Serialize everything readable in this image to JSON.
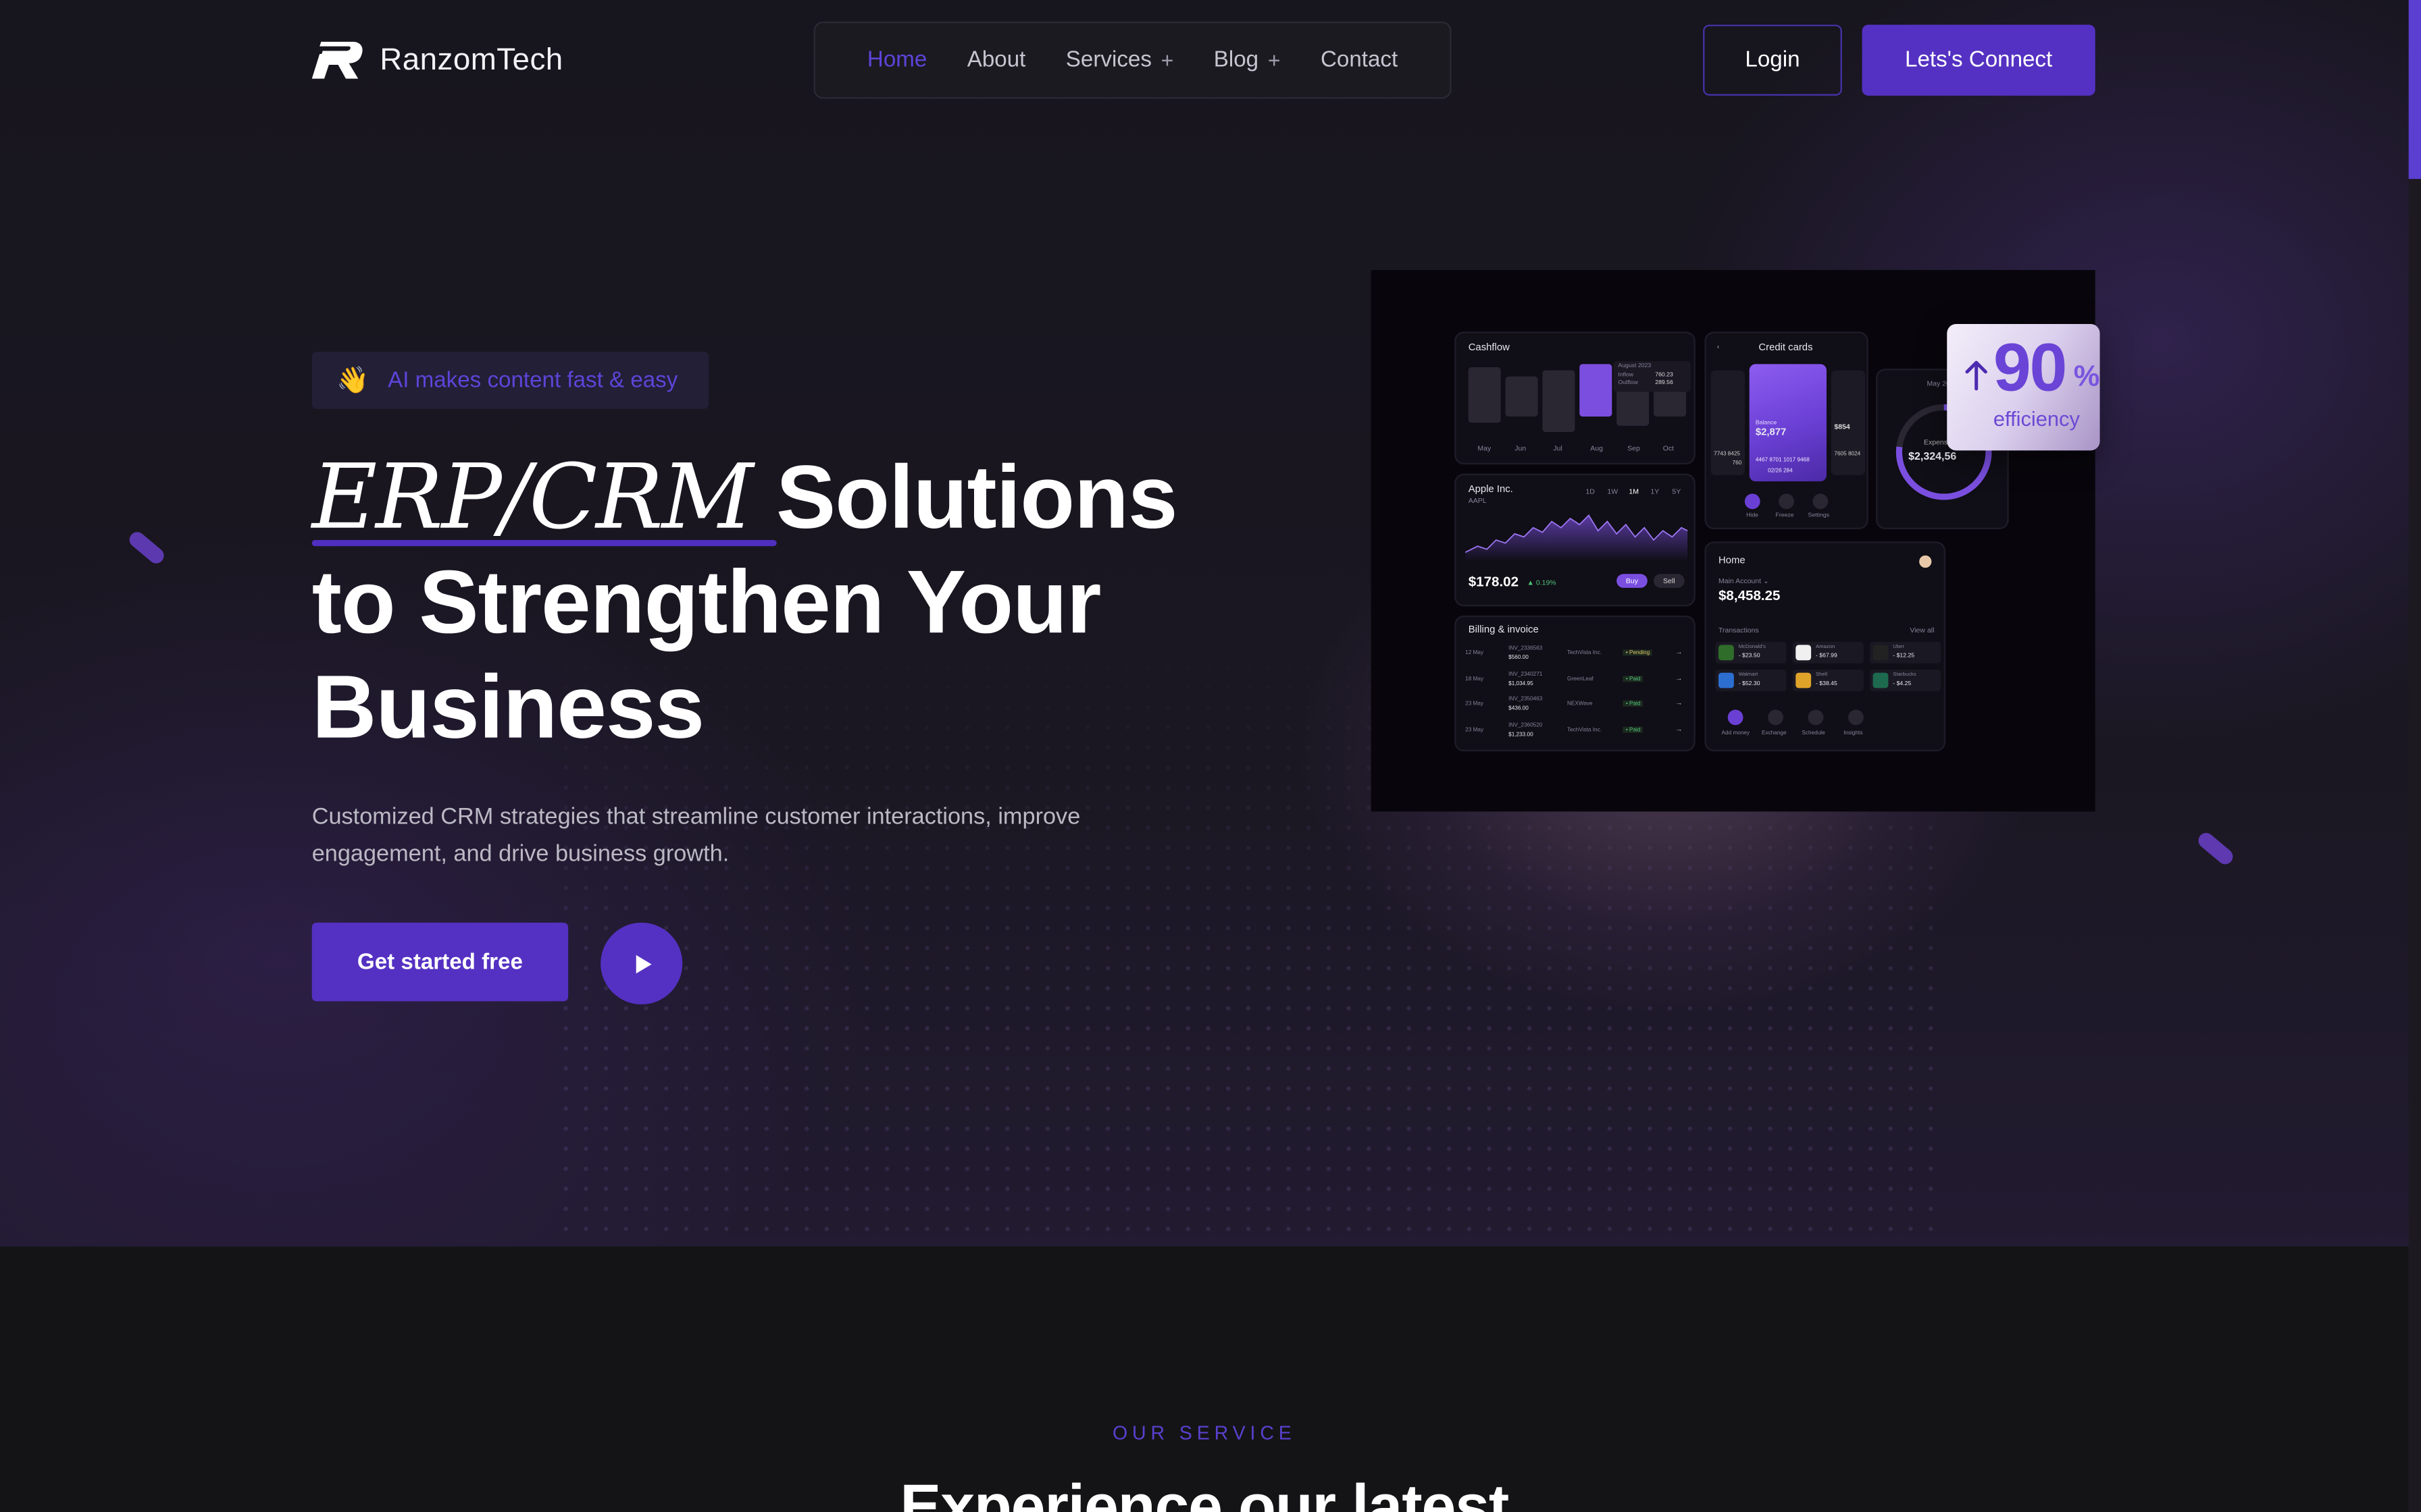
{
  "brand": {
    "name": "RanzomTech",
    "logo_icon": "r-logo-icon"
  },
  "nav": {
    "items": [
      {
        "label": "Home",
        "active": true,
        "has_submenu": false
      },
      {
        "label": "About",
        "active": false,
        "has_submenu": false
      },
      {
        "label": "Services",
        "active": false,
        "has_submenu": true
      },
      {
        "label": "Blog",
        "active": false,
        "has_submenu": true
      },
      {
        "label": "Contact",
        "active": false,
        "has_submenu": false
      }
    ],
    "submenu_glyph": "+"
  },
  "header": {
    "login_label": "Login",
    "connect_label": "Lets's Connect"
  },
  "hero": {
    "badge_icon": "👋",
    "badge_text": "AI makes content fast & easy",
    "title_highlight": "ERP/CRM",
    "title_line1_rest": " Solutions",
    "title_line2": "to Strengthen Your",
    "title_line3": "Business",
    "subtitle": "Customized CRM strategies that streamline customer interactions, improve engagement, and drive business growth.",
    "cta_label": "Get started free",
    "play_icon": "play-icon"
  },
  "dashboard": {
    "cashflow": {
      "title": "Cashflow",
      "months": [
        "May",
        "Jun",
        "Jul",
        "Aug",
        "Sep",
        "Oct"
      ],
      "tooltip_date": "August 2023",
      "tooltip_inflow_label": "Inflow",
      "tooltip_inflow": "760.23",
      "tooltip_outflow_label": "Outflow",
      "tooltip_outflow": "289.56"
    },
    "stock": {
      "name": "Apple Inc.",
      "ticker": "AAPL",
      "ranges": [
        "1D",
        "1W",
        "1M",
        "1Y",
        "5Y"
      ],
      "price": "$178.02",
      "change": "▲ 0.19%",
      "buy_label": "Buy",
      "sell_label": "Sell"
    },
    "billing": {
      "title": "Billing & invoice",
      "rows": [
        {
          "date": "12 May",
          "id": "INV_2336563",
          "amount": "$560.00",
          "client": "TechVista Inc.",
          "status": "• Pending"
        },
        {
          "date": "18 May",
          "id": "INV_2340271",
          "amount": "$1,034.95",
          "client": "GreenLeaf",
          "status": "• Paid"
        },
        {
          "date": "23 May",
          "id": "INV_2350463",
          "amount": "$436.00",
          "client": "NEXWave",
          "status": "• Paid"
        },
        {
          "date": "23 May",
          "id": "INV_2360520",
          "amount": "$1,233.00",
          "client": "TechVista Inc.",
          "status": "• Paid"
        }
      ]
    },
    "credit_cards": {
      "title": "Credit cards",
      "balance_label": "Balance",
      "balance": "$2,877",
      "number": "4467 8701 1017 9468",
      "expiry_cvv": "02/26   284",
      "side_left": "7743 8425",
      "side_left2": "760",
      "side_right": "$854",
      "side_right2": "7605 8024",
      "actions": [
        "Hide",
        "Freeze",
        "Settings"
      ]
    },
    "expenses": {
      "label": "Expenses",
      "amount": "$2,324,56",
      "month": "May 2023"
    },
    "home": {
      "title": "Home",
      "account_label": "Main Account ⌄",
      "account_balance": "$8,458.25",
      "transactions_label": "Transactions",
      "view_all": "View all",
      "transactions": [
        {
          "name": "McDonald's",
          "amount": "- $23.50"
        },
        {
          "name": "Amazon",
          "amount": "- $67.99"
        },
        {
          "name": "Uber",
          "amount": "- $12.25"
        },
        {
          "name": "Walmart",
          "amount": "- $52.30"
        },
        {
          "name": "Shell",
          "amount": "- $38.45"
        },
        {
          "name": "Starbucks",
          "amount": "- $4.25"
        }
      ],
      "actions": [
        "Add money",
        "Exchange",
        "Schedule",
        "Insights"
      ]
    }
  },
  "efficiency": {
    "value": "90",
    "unit": "%",
    "label": "efficiency",
    "icon": "arrow-up-icon"
  },
  "services": {
    "eyebrow": "OUR SERVICE",
    "title": "Experience our latest"
  },
  "colors": {
    "accent": "#5431c2",
    "accent_text": "#5e44d8",
    "background": "#17151d"
  }
}
